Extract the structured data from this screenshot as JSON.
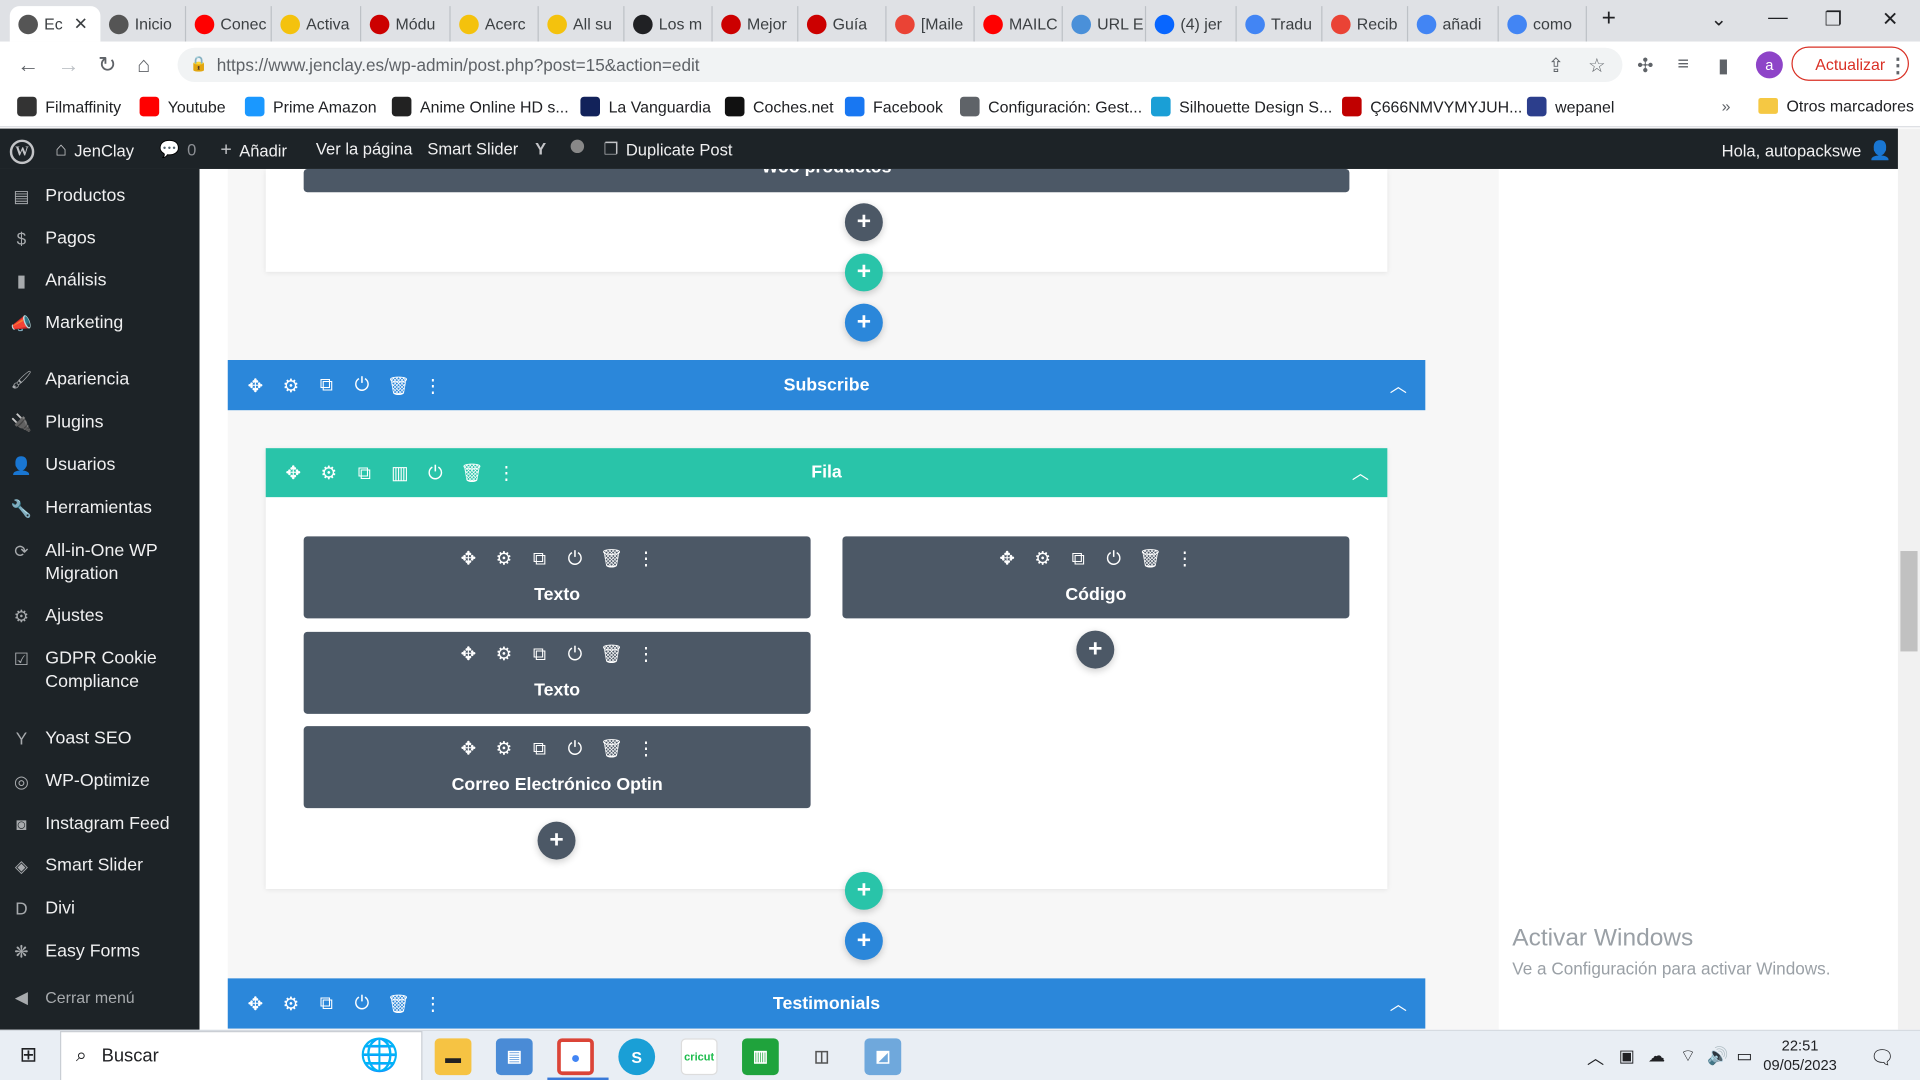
{
  "browser": {
    "tabs": [
      {
        "label": "Ec",
        "icon": "wordpress-icon",
        "color": "#555555"
      },
      {
        "label": "Inicio",
        "icon": "wordpress-icon",
        "color": "#555555"
      },
      {
        "label": "Conec",
        "icon": "youtube-icon",
        "color": "#ff0000"
      },
      {
        "label": "Activa",
        "icon": "norton-icon",
        "color": "#f4c20d"
      },
      {
        "label": "Módu",
        "icon": "wepanel-icon",
        "color": "#cc0000"
      },
      {
        "label": "Acerc",
        "icon": "norton-icon",
        "color": "#f4c20d"
      },
      {
        "label": "All su",
        "icon": "norton-icon",
        "color": "#f4c20d"
      },
      {
        "label": "Los m",
        "icon": "gn-icon",
        "color": "#202124"
      },
      {
        "label": "Mejor",
        "icon": "wepanel-icon",
        "color": "#cc0000"
      },
      {
        "label": "Guía",
        "icon": "wepanel-icon",
        "color": "#cc0000"
      },
      {
        "label": "[Maile",
        "icon": "gmail-icon",
        "color": "#ea4335"
      },
      {
        "label": "MAILC",
        "icon": "youtube-icon",
        "color": "#ff0000"
      },
      {
        "label": "URL E",
        "icon": "url-icon",
        "color": "#4a90d9"
      },
      {
        "label": "(4) jer",
        "icon": "meta-icon",
        "color": "#0866ff"
      },
      {
        "label": "Tradu",
        "icon": "translate-icon",
        "color": "#4285f4"
      },
      {
        "label": "Recib",
        "icon": "gmail-icon",
        "color": "#ea4335"
      },
      {
        "label": "añadi",
        "icon": "google-icon",
        "color": "#4285f4"
      },
      {
        "label": "como",
        "icon": "google-icon",
        "color": "#4285f4"
      }
    ],
    "url": "https://www.jenclay.es/wp-admin/post.php?post=15&action=edit",
    "update_label": "Actualizar",
    "profile_initial": "a",
    "bookmarks": [
      {
        "label": "Filmaffinity",
        "icon": "filmaffinity-icon",
        "color": "#333333"
      },
      {
        "label": "Youtube",
        "icon": "youtube-icon",
        "color": "#ff0000"
      },
      {
        "label": "Prime Amazon",
        "icon": "prime-icon",
        "color": "#1a98ff"
      },
      {
        "label": "Anime Online HD s...",
        "icon": "anime-icon",
        "color": "#222222"
      },
      {
        "label": "La Vanguardia",
        "icon": "vanguardia-icon",
        "color": "#12225a"
      },
      {
        "label": "Coches.net",
        "icon": "coches-icon",
        "color": "#111111"
      },
      {
        "label": "Facebook",
        "icon": "facebook-icon",
        "color": "#1877f2"
      },
      {
        "label": "Configuración: Gest...",
        "icon": "gear-icon",
        "color": "#5f6368"
      },
      {
        "label": "Silhouette Design S...",
        "icon": "silhouette-icon",
        "color": "#1a9fd6"
      },
      {
        "label": "Ç666NMVYMYJUH...",
        "icon": "bookmark-red-icon",
        "color": "#c00000"
      },
      {
        "label": "wepanel",
        "icon": "wepanel-icon",
        "color": "#2c3e8c"
      }
    ],
    "other_bookmarks": "Otros marcadores"
  },
  "adminbar": {
    "site": "JenClay",
    "comments": "0",
    "add": "Añadir",
    "view": "Ver la página",
    "slider": "Smart Slider",
    "duplicate": "Duplicate Post",
    "greeting": "Hola, autopackswe"
  },
  "sidebar": {
    "items": [
      {
        "label": "Productos",
        "icon": "products-icon"
      },
      {
        "label": "Pagos",
        "icon": "payments-icon"
      },
      {
        "label": "Análisis",
        "icon": "analytics-icon"
      },
      {
        "label": "Marketing",
        "icon": "marketing-icon"
      },
      {
        "label": "Apariencia",
        "icon": "brush-icon"
      },
      {
        "label": "Plugins",
        "icon": "plugin-icon"
      },
      {
        "label": "Usuarios",
        "icon": "users-icon"
      },
      {
        "label": "Herramientas",
        "icon": "wrench-icon"
      },
      {
        "label": "All-in-One WP Migration",
        "icon": "migration-icon"
      },
      {
        "label": "Ajustes",
        "icon": "settings-icon"
      },
      {
        "label": "GDPR Cookie Compliance",
        "icon": "gdpr-icon"
      },
      {
        "label": "Yoast SEO",
        "icon": "yoast-icon"
      },
      {
        "label": "WP-Optimize",
        "icon": "optimize-icon"
      },
      {
        "label": "Instagram Feed",
        "icon": "instagram-icon"
      },
      {
        "label": "Smart Slider",
        "icon": "slider-icon"
      },
      {
        "label": "Divi",
        "icon": "divi-icon"
      },
      {
        "label": "Easy Forms",
        "icon": "forms-icon"
      },
      {
        "label": "Cerrar menú",
        "icon": "collapse-icon"
      }
    ]
  },
  "builder": {
    "top_module": "Woo productos",
    "subscribe_section": "Subscribe",
    "row": "Fila",
    "modules_left": [
      "Texto",
      "Texto",
      "Correo Electrónico Optin"
    ],
    "modules_right": [
      "Código"
    ],
    "testimonials_section": "Testimonials"
  },
  "watermark": {
    "title": "Activar Windows",
    "subtitle": "Ve a Configuración para activar Windows."
  },
  "taskbar": {
    "search": "Buscar",
    "time": "22:51",
    "date": "09/05/2023"
  }
}
